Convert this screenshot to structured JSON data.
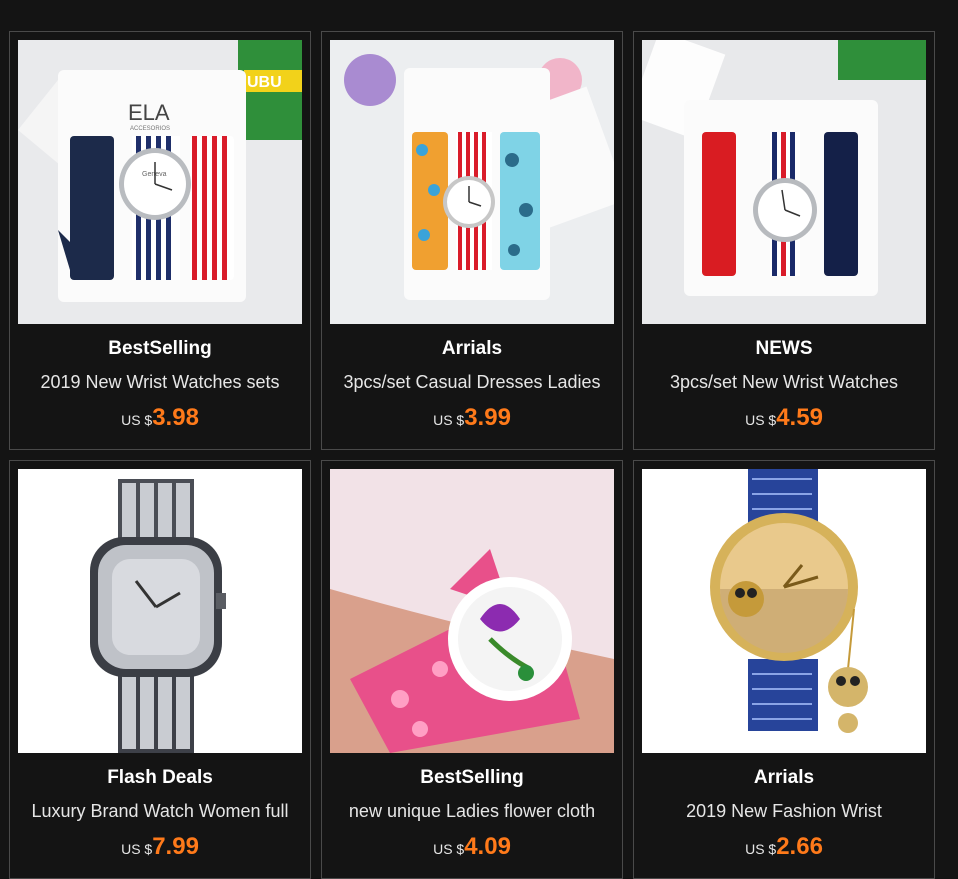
{
  "products": [
    {
      "label": "BestSelling",
      "title": "2019 New Wrist Watches sets",
      "currency": "US $",
      "price": "3.98",
      "image": "watch-set-stripes-image"
    },
    {
      "label": "Arrials",
      "title": "3pcs/set Casual Dresses Ladies",
      "currency": "US $",
      "price": "3.99",
      "image": "watch-set-floral-image"
    },
    {
      "label": "NEWS",
      "title": "3pcs/set New Wrist Watches",
      "currency": "US $",
      "price": "4.59",
      "image": "watch-set-nylon-image"
    },
    {
      "label": "Flash Deals",
      "title": "Luxury Brand Watch Women full",
      "currency": "US $",
      "price": "7.99",
      "image": "diamond-watch-image"
    },
    {
      "label": "BestSelling",
      "title": "new unique Ladies flower cloth",
      "currency": "US $",
      "price": "4.09",
      "image": "flower-cloth-watch-image"
    },
    {
      "label": "Arrials",
      "title": "2019 New Fashion Wrist",
      "currency": "US $",
      "price": "2.66",
      "image": "owl-pendant-watch-image"
    }
  ],
  "image_text": {
    "brand_card": "ELA",
    "brand_sub": "ACCESORIOS",
    "cup_text": "UBU",
    "dial_brand": "Geneva"
  }
}
